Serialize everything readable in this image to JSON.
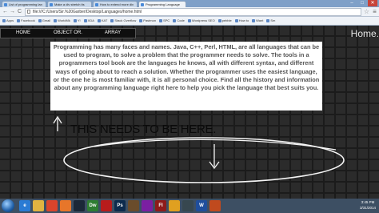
{
  "browser": {
    "tabs": [
      {
        "label": "List of programming lan",
        "active": false
      },
      {
        "label": "Make a div stretch its",
        "active": false
      },
      {
        "label": "How to extend more div",
        "active": false
      },
      {
        "label": "Programming Language",
        "active": true
      }
    ],
    "window_controls": {
      "minimize": "–",
      "maximize": "□",
      "close": "✕"
    },
    "nav": {
      "back": "←",
      "forward": "→",
      "reload": "C"
    },
    "address": "file:///C:/Users/Sir.%20Garber/Desktop/Languages/home.html",
    "bookmarks": [
      "Apps",
      "Facebook",
      "Gmail",
      "WorldMk",
      "Y!",
      "XDA",
      "KAT",
      "Stack Overflow",
      "Pastmon",
      "SPC",
      "Code",
      "Wordpress SEO",
      "pebble",
      "How to",
      "Want",
      "Sm"
    ]
  },
  "site": {
    "nav": [
      "HOME",
      "OBJECT OR.",
      "ARRAY"
    ],
    "brand": "Home.",
    "content": "Programming has many faces and names. Java, C++, Perl, HTML, are all languages that can be used to program, to solve a problem that the programmer needs to solve. The tools in a programmers tool book are the languages he knows, all with different syntax, and different ways of going about to reach a solution. Whether the programmer uses the easiest language, or the one he is most familiar with, it is all personal choice. Find all the history and information about any programming language right here to help you pick the language that best suits you.",
    "annotation": "THIS NEEDS TO BE HERE."
  },
  "taskbar": {
    "icons": [
      {
        "name": "ie-icon",
        "label": "e",
        "color": "#2a7bd4"
      },
      {
        "name": "folder-icon",
        "label": "",
        "color": "#e0b341"
      },
      {
        "name": "chrome-icon",
        "label": "",
        "color": "#d9442c"
      },
      {
        "name": "firefox-icon",
        "label": "",
        "color": "#e7762a"
      },
      {
        "name": "steam-icon",
        "label": "",
        "color": "#1b2838"
      },
      {
        "name": "dreamweaver-icon",
        "label": "Dw",
        "color": "#2e7d32"
      },
      {
        "name": "acrobat-icon",
        "label": "",
        "color": "#b71c1c"
      },
      {
        "name": "photoshop-icon",
        "label": "Ps",
        "color": "#0d2b4d"
      },
      {
        "name": "app-icon",
        "label": "",
        "color": "#6a4c2b"
      },
      {
        "name": "app-icon-2",
        "label": "",
        "color": "#7b1fa2"
      },
      {
        "name": "flash-icon",
        "label": "Fl",
        "color": "#8e1b1b"
      },
      {
        "name": "app-icon-3",
        "label": "",
        "color": "#e0a020"
      },
      {
        "name": "app-icon-4",
        "label": "",
        "color": "#37474f"
      },
      {
        "name": "word-icon",
        "label": "W",
        "color": "#1f4e9c"
      },
      {
        "name": "app-icon-5",
        "label": "",
        "color": "#c04a1e"
      }
    ],
    "time": "3:45 PM",
    "date": "3/31/2014"
  }
}
